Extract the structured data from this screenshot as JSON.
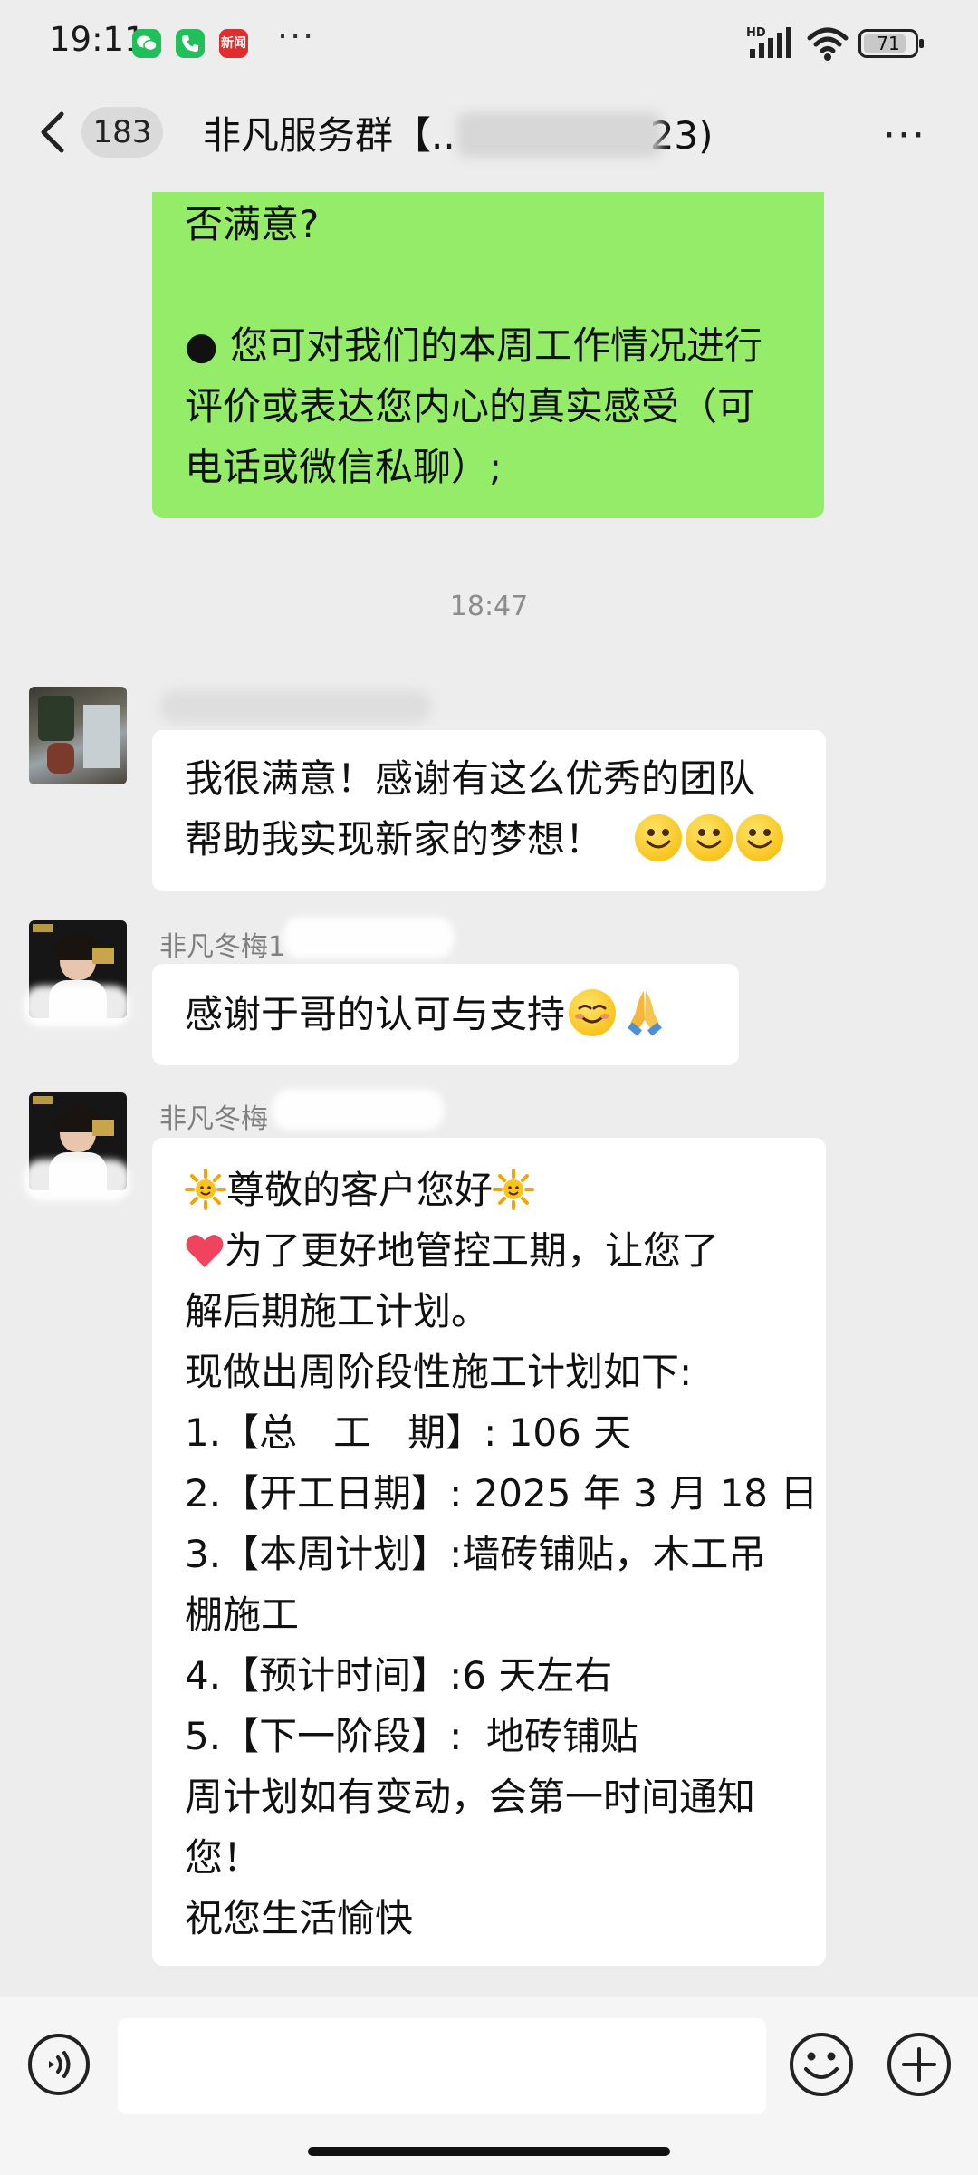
{
  "status_bar": {
    "time": "19:11",
    "hd_label": "HD",
    "battery": "71",
    "more": "···",
    "app_icons": [
      "wechat-icon",
      "phone-icon",
      "news-app-icon"
    ]
  },
  "header": {
    "back_badge": "183",
    "title_start": "非凡服务群【..",
    "title_end": "23)",
    "more": "···"
  },
  "messages": {
    "prev_outgoing": {
      "lines": [
        "否满意?",
        "",
        "● 您可对我们的本周工作情况进行",
        "评价或表达您内心的真实感受（可",
        "电话或微信私聊）;"
      ]
    },
    "timestamp": "18:47",
    "msg1": {
      "lines": [
        "我很满意！感谢有这么优秀的团队",
        "帮助我实现新家的梦想！"
      ],
      "emoji_count": 3
    },
    "msg2": {
      "sender": "非凡冬梅1",
      "text": "感谢于哥的认可与支持"
    },
    "msg3": {
      "sender": "非凡冬梅",
      "greeting": "尊敬的客户您好",
      "line2": "为了更好地管控工期，让您了",
      "lines": [
        "解后期施工计划。",
        "现做出周阶段性施工计划如下:",
        "1.【总   工   期】: 106 天",
        "2.【开工日期】: 2025 年 3 月 18 日",
        "3.【本周计划】:墙砖铺贴，木工吊",
        "棚施工",
        "4.【预计时间】:6 天左右",
        "5.【下一阶段】:  地砖铺贴",
        "周计划如有变动，会第一时间通知",
        "您！",
        "祝您生活愉快"
      ]
    }
  },
  "input": {
    "placeholder": ""
  }
}
